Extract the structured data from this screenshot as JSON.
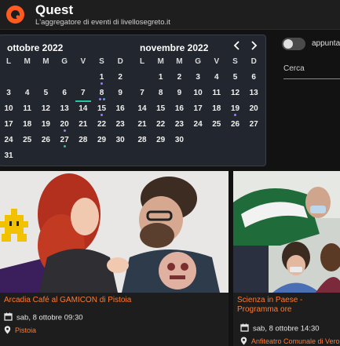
{
  "app": {
    "title": "Quest",
    "subtitle": "L'aggregatore di eventi di livellosegreto.it",
    "brand_color": "#ff5a1f",
    "logo_icon": "quest-logo"
  },
  "calendar": {
    "weekdays": [
      "L",
      "M",
      "M",
      "G",
      "V",
      "S",
      "D"
    ],
    "selected_color": "#26c6a0",
    "dot_colors": {
      "purple": "#9b7cf0",
      "teal": "#26c6a0",
      "blue": "#4aa3ff"
    },
    "months": [
      {
        "title": "ottobre 2022",
        "weeks": [
          [
            "",
            "",
            "",
            "",
            "",
            "1",
            "2"
          ],
          [
            "3",
            "4",
            "5",
            "6",
            "7",
            "8",
            "9"
          ],
          [
            "10",
            "11",
            "12",
            "13",
            "14",
            "15",
            "16"
          ],
          [
            "17",
            "18",
            "19",
            "20",
            "21",
            "22",
            "23"
          ],
          [
            "24",
            "25",
            "26",
            "27",
            "28",
            "29",
            "30"
          ],
          [
            "31",
            "",
            "",
            "",
            "",
            "",
            ""
          ]
        ],
        "selected_day": "7",
        "markers": {
          "1": [
            "purple"
          ],
          "8": [
            "purple",
            "blue"
          ],
          "15": [
            "purple"
          ],
          "20": [
            "purple"
          ],
          "27": [
            "teal"
          ]
        }
      },
      {
        "title": "novembre 2022",
        "weeks": [
          [
            "",
            "1",
            "2",
            "3",
            "4",
            "5",
            "6"
          ],
          [
            "7",
            "8",
            "9",
            "10",
            "11",
            "12",
            "13"
          ],
          [
            "14",
            "15",
            "16",
            "17",
            "18",
            "19",
            "20"
          ],
          [
            "21",
            "22",
            "23",
            "24",
            "25",
            "26",
            "27"
          ],
          [
            "28",
            "29",
            "30",
            "",
            "",
            "",
            ""
          ]
        ],
        "selected_day": "",
        "markers": {
          "19": [
            "purple"
          ]
        }
      }
    ],
    "prev_icon": "chevron-left-icon",
    "next_icon": "chevron-right-icon"
  },
  "filters": {
    "toggle_label": "appunta",
    "toggle_on": false,
    "search_placeholder": "Cerca"
  },
  "events": [
    {
      "title": "Arcadia Café al GAMICON di Pistoia",
      "date": "sab, 8 ottobre 09:30",
      "location": "Pistoia"
    },
    {
      "title": "Scienza in Paese - Programma ore",
      "date": "sab, 8 ottobre 14:30",
      "location": "Anfiteatro Comunale di Verona"
    }
  ]
}
